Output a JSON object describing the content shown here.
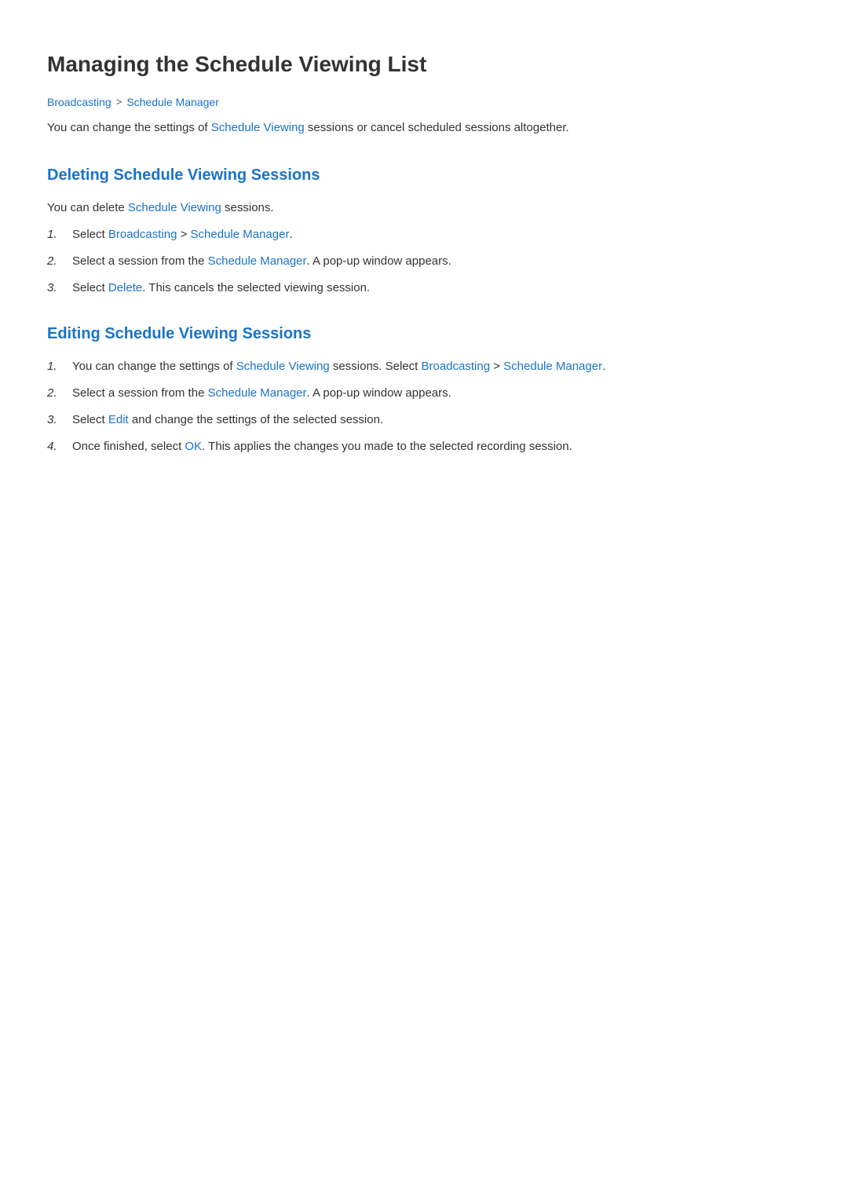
{
  "page": {
    "title": "Managing the Schedule Viewing List",
    "breadcrumb": {
      "item1": "Broadcasting",
      "separator": ">",
      "item2": "Schedule Manager"
    },
    "intro": {
      "prefix": "You can change the settings of ",
      "highlight1": "Schedule Viewing",
      "suffix": " sessions or cancel scheduled sessions altogether."
    },
    "section1": {
      "title": "Deleting Schedule Viewing Sessions",
      "intro_prefix": "You can delete ",
      "intro_highlight": "Schedule Viewing",
      "intro_suffix": " sessions.",
      "steps": [
        {
          "number": "1.",
          "prefix": "Select ",
          "h1": "Broadcasting",
          "sep": " > ",
          "h2": "Schedule Manager",
          "suffix": "."
        },
        {
          "number": "2.",
          "prefix": "Select a session from the ",
          "h1": "Schedule Manager",
          "suffix": ". A pop-up window appears."
        },
        {
          "number": "3.",
          "prefix": "Select ",
          "h1": "Delete",
          "suffix": ". This cancels the selected viewing session."
        }
      ]
    },
    "section2": {
      "title": "Editing Schedule Viewing Sessions",
      "steps": [
        {
          "number": "1.",
          "prefix": "You can change the settings of ",
          "h1": "Schedule Viewing",
          "middle": " sessions. Select ",
          "h2": "Broadcasting",
          "sep": " > ",
          "h3": "Schedule Manager",
          "suffix": "."
        },
        {
          "number": "2.",
          "prefix": "Select a session from the ",
          "h1": "Schedule Manager",
          "suffix": ". A pop-up window appears."
        },
        {
          "number": "3.",
          "prefix": "Select ",
          "h1": "Edit",
          "suffix": " and change the settings of the selected session."
        },
        {
          "number": "4.",
          "prefix": "Once finished, select ",
          "h1": "OK",
          "suffix": ". This applies the changes you made to the selected recording session."
        }
      ]
    }
  }
}
